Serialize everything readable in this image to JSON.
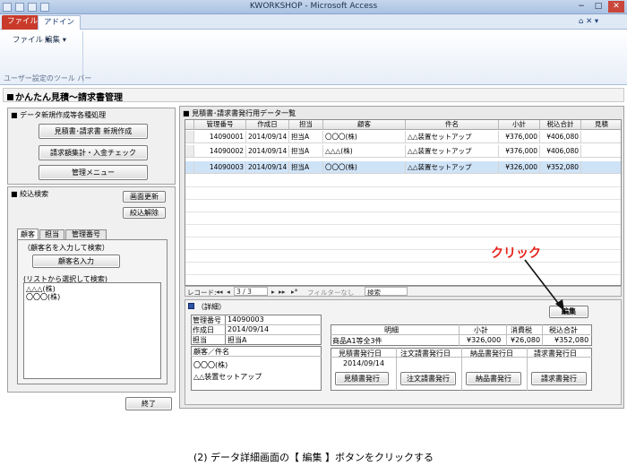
{
  "window": {
    "title": "KWORKSHOP - Microsoft Access",
    "controls": [
      "−",
      "□",
      "✕"
    ]
  },
  "ribbon": {
    "tabs": [
      "ファイル",
      "アドイン"
    ],
    "menus": [
      "ファイル ▾",
      "編集 ▾"
    ],
    "group_label": "ユーザー設定のツール バー",
    "help": "⌂ ✕ ▾"
  },
  "form": {
    "title": "かんたん見積～請求書管理"
  },
  "left_panel": {
    "section1_title": "■ データ新規作成等各種処理",
    "buttons": [
      "見積書･請求書 新規作成",
      "請求額集計・入金チェック",
      "管理メニュー"
    ],
    "section2_title": "■ 絞込検索",
    "refresh_button": "画面更新",
    "clear_button": "絞込解除",
    "search_tabs": [
      "顧客",
      "担当",
      "管理番号"
    ],
    "hint1": "（顧客名を入力して検索）",
    "input_button": "顧客名入力",
    "hint2": "(リストから選択して検索)",
    "customer_list": [
      "△△△(株)",
      "〇〇〇(株)"
    ],
    "exit_button": "終了"
  },
  "grid": {
    "panel_title": "■ 見積書･請求書発行用データ一覧",
    "columns": [
      "管理番号",
      "作成日",
      "担当",
      "顧客",
      "件名",
      "小計",
      "税込合計",
      "見積"
    ],
    "rows": [
      [
        "14090001",
        "2014/09/14",
        "担当A",
        "〇〇〇(株)",
        "△△装置セットアップ",
        "¥376,000",
        "¥406,080"
      ],
      [
        "14090002",
        "2014/09/14",
        "担当A",
        "△△△(株)",
        "△△装置セットアップ",
        "¥376,000",
        "¥406,080"
      ],
      [
        "14090003",
        "2014/09/14",
        "担当A",
        "〇〇〇(株)",
        "△△装置セットアップ",
        "¥326,000",
        "¥352,080"
      ]
    ]
  },
  "navbar": {
    "record_label": "レコード:",
    "first": "◂◂",
    "prev": "◂",
    "position": "3 / 3",
    "next": "▸",
    "last": "▸▸",
    "new": "▸*",
    "filter": "フィルターなし",
    "search": "検索"
  },
  "detail": {
    "title": "（詳細）",
    "labels": [
      "管理番号",
      "作成日",
      "担当"
    ],
    "values": [
      "14090003",
      "2014/09/14",
      "担当A"
    ],
    "customer_header": "顧客／件名",
    "customer": "〇〇〇(株)",
    "subject": "△△装置セットアップ",
    "edit_button": "編集",
    "meisai_header": "明細",
    "subtotal_header": "小計",
    "tax_header": "消費税",
    "total_header": "税込合計",
    "line_item": "商品A1等全3件",
    "subtotal": "¥326,000",
    "tax": "¥26,080",
    "total": "¥352,080",
    "issue_headers": [
      "見積書発行日",
      "注文請書発行日",
      "納品書発行日",
      "請求書発行日"
    ],
    "issue_date": "2014/09/14",
    "issue_buttons": [
      "見積書発行",
      "注文請書発行",
      "納品書発行",
      "請求書発行"
    ]
  },
  "annotation": "クリック",
  "caption": "(2) データ詳細画面の【 編集 】ボタンをクリックする",
  "colors": {
    "annotation": "#e8221b",
    "file_tab": "#c93a2a",
    "selected_row": "#cfe3f7"
  }
}
